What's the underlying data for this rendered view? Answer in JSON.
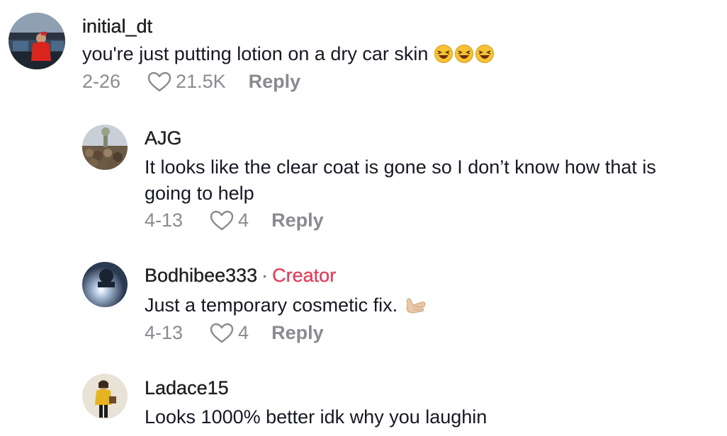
{
  "comments": [
    {
      "username": "initial_dt",
      "text": "you're just putting lotion on a dry car skin",
      "emoji": "laughing-face-x3",
      "date": "2-26",
      "likes": "21.5K",
      "reply_label": "Reply"
    },
    {
      "username": "AJG",
      "text_lines": [
        "It looks like the clear coat is gone so I don’t know how that is",
        "going to help"
      ],
      "date": "4-13",
      "likes": "4",
      "reply_label": "Reply"
    },
    {
      "username": "Bodhibee333",
      "separator": "·",
      "badge": "Creator",
      "text": "Just a temporary cosmetic fix.",
      "emoji": "call-me-hand",
      "date": "4-13",
      "likes": "4",
      "reply_label": "Reply"
    },
    {
      "username": "Ladace15",
      "text": "Looks 1000% better idk why you laughin"
    }
  ],
  "colors": {
    "creator_badge": "#e0415e",
    "meta_text": "#8a8b91"
  }
}
